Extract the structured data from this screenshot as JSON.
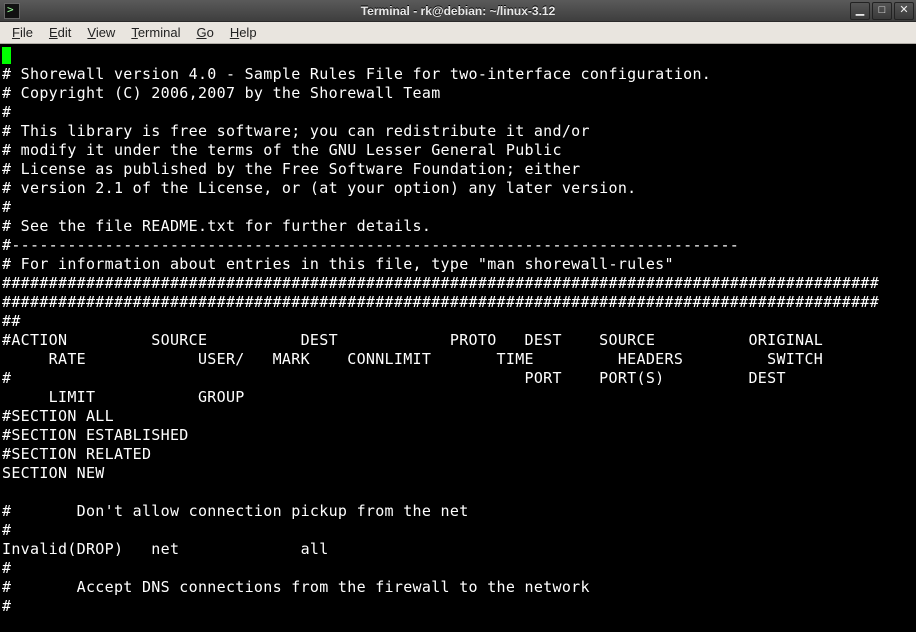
{
  "window": {
    "title": "Terminal - rk@debian: ~/linux-3.12",
    "min_label": "▁",
    "max_label": "□",
    "close_label": "✕"
  },
  "menubar": {
    "file": "File",
    "edit": "Edit",
    "view": "View",
    "terminal": "Terminal",
    "go": "Go",
    "help": "Help"
  },
  "lines": {
    "l0": "#",
    "l1": "# Shorewall version 4.0 - Sample Rules File for two-interface configuration.",
    "l2": "# Copyright (C) 2006,2007 by the Shorewall Team",
    "l3": "#",
    "l4": "# This library is free software; you can redistribute it and/or",
    "l5": "# modify it under the terms of the GNU Lesser General Public",
    "l6": "# License as published by the Free Software Foundation; either",
    "l7": "# version 2.1 of the License, or (at your option) any later version.",
    "l8": "#",
    "l9": "# See the file README.txt for further details.",
    "l10": "#------------------------------------------------------------------------------",
    "l11": "# For information about entries in this file, type \"man shorewall-rules\"",
    "l12": "##############################################################################################",
    "l13": "##############################################################################################",
    "l14": "##",
    "l15": "#ACTION         SOURCE          DEST            PROTO   DEST    SOURCE          ORIGINAL",
    "l16": "     RATE            USER/   MARK    CONNLIMIT       TIME         HEADERS         SWITCH",
    "l17": "#                                                       PORT    PORT(S)         DEST",
    "l18": "     LIMIT           GROUP",
    "l19": "#SECTION ALL",
    "l20": "#SECTION ESTABLISHED",
    "l21": "#SECTION RELATED",
    "l22": "SECTION NEW",
    "l23": "",
    "l24": "#       Don't allow connection pickup from the net",
    "l25": "#",
    "l26": "Invalid(DROP)   net             all",
    "l27": "#",
    "l28": "#       Accept DNS connections from the firewall to the network",
    "l29": "#"
  }
}
